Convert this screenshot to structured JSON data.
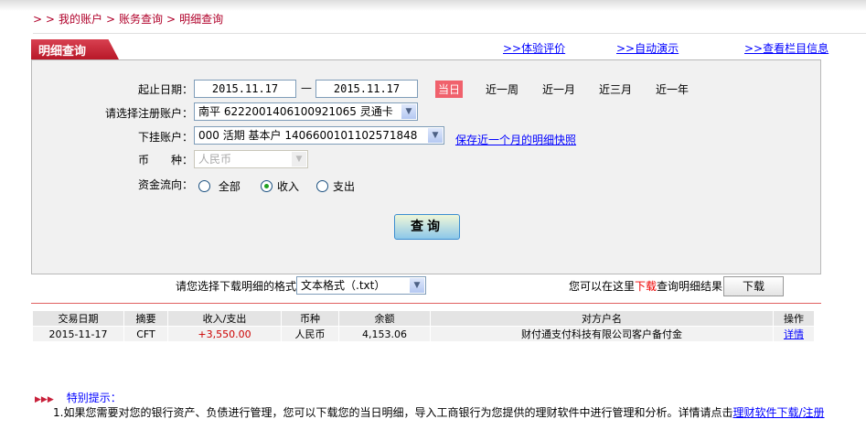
{
  "breadcrumb": [
    "> >",
    "我的账户",
    ">",
    "账务查询",
    ">",
    "明细查询"
  ],
  "tab_title": "明细查询",
  "top_links": [
    ">>体验评价",
    ">>自动演示",
    ">>查看栏目信息"
  ],
  "form": {
    "date_label": "起止日期：",
    "start_date": "2015.11.17",
    "dash": "—",
    "end_date": "2015.11.17",
    "quick": [
      "当日",
      "近一周",
      "近一月",
      "近三月",
      "近一年"
    ],
    "account_label": "请选择注册账户：",
    "account_value": "南平 6222001406100921065 灵通卡",
    "sub_label": "下挂账户：",
    "sub_value": "000 活期 基本户 1406600101102571848",
    "snapshot_link": "保存近一个月的明细快照",
    "currency_label": "币　　种：",
    "currency_value": "人民币",
    "flow_label": "资金流向：",
    "flow_options": [
      "全部",
      "收入",
      "支出"
    ],
    "flow_selected": "收入",
    "query_button": "查询"
  },
  "download": {
    "format_label": "请您选择下载明细的格式",
    "format_value": "文本格式（.txt）",
    "hint_pre": "您可以在这里",
    "hint_red": "下载",
    "hint_post": "查询明细结果",
    "button": "下载"
  },
  "table": {
    "headers": [
      "交易日期",
      "摘要",
      "收入/支出",
      "币种",
      "余额",
      "对方户名",
      "操作"
    ],
    "rows": [
      [
        "2015-11-17",
        "CFT",
        "+3,550.00",
        "人民币",
        "4,153.06",
        "财付通支付科技有限公司客户备付金",
        "详情"
      ]
    ]
  },
  "tips": {
    "title": "特别提示：",
    "text": "1.如果您需要对您的银行资产、负债进行管理，您可以下载您的当日明细，导入工商银行为您提供的理财软件中进行管理和分析。详情请点击",
    "link": "理财软件下载/注册"
  },
  "colors": {
    "brand": "#b81828",
    "income": "#cc0000",
    "link": "#0000ff"
  }
}
